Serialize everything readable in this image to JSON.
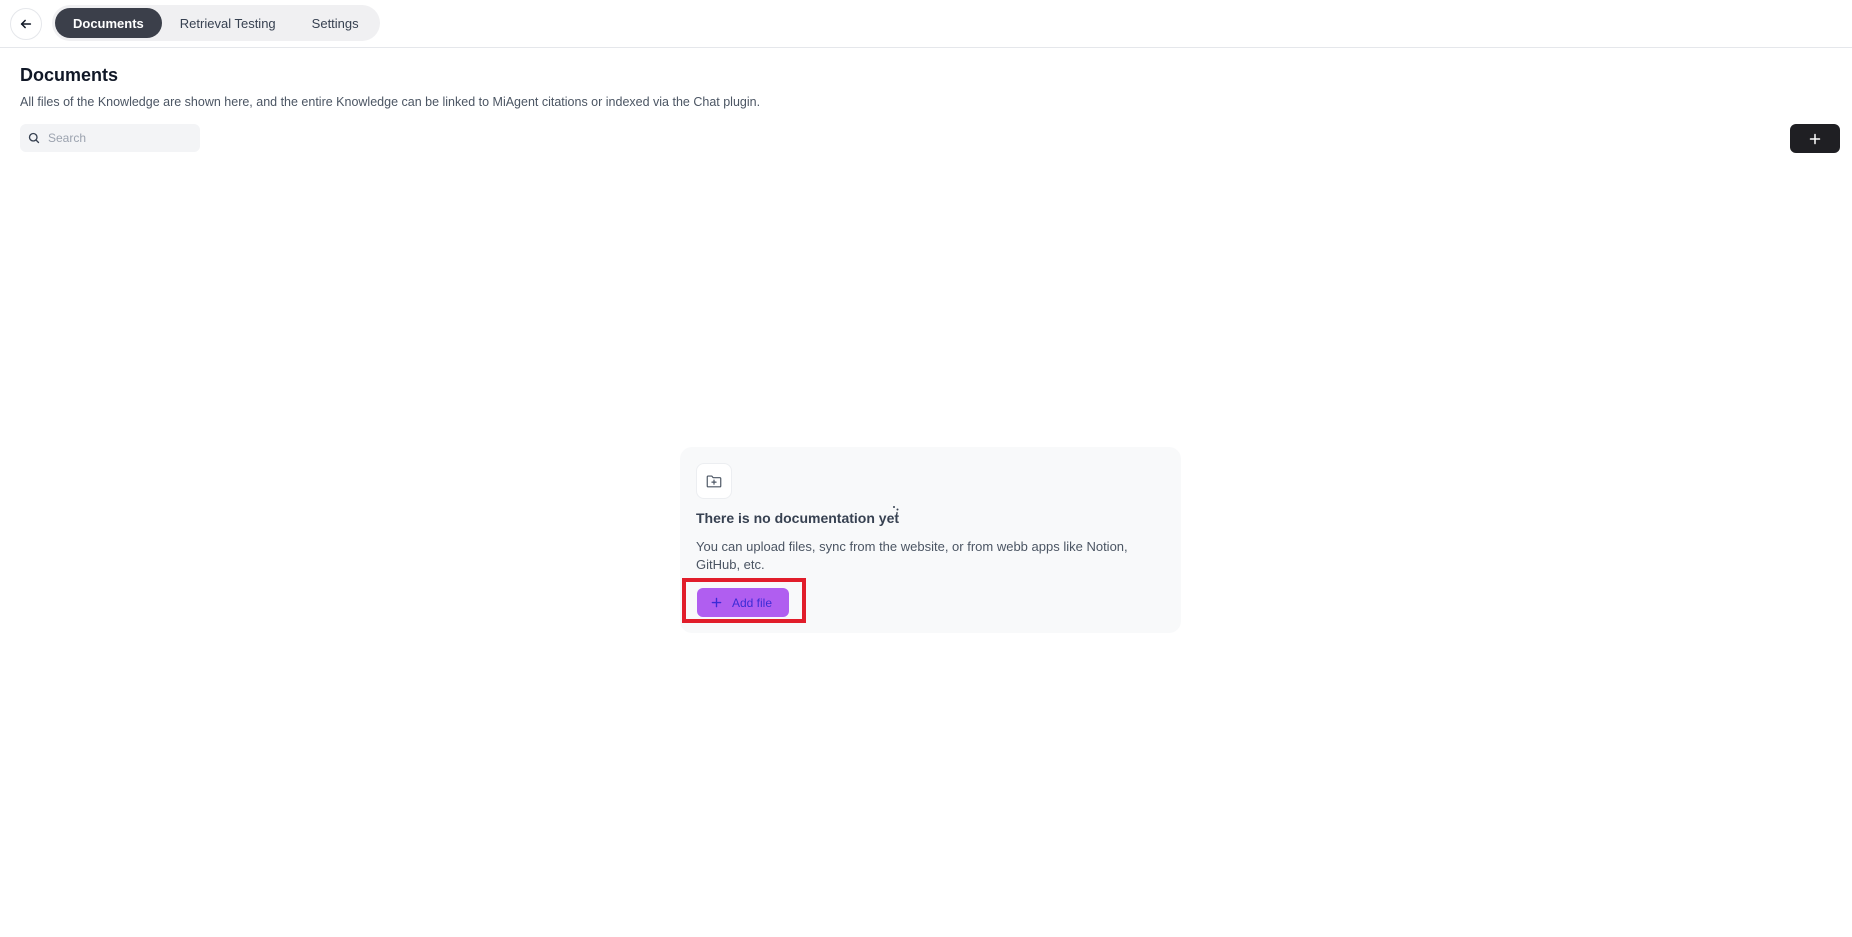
{
  "topbar": {
    "back_icon": "arrow-left-icon",
    "tabs": [
      {
        "label": "Documents",
        "active": true
      },
      {
        "label": "Retrieval Testing",
        "active": false
      },
      {
        "label": "Settings",
        "active": false
      }
    ]
  },
  "header": {
    "title": "Documents",
    "description": "All files of the Knowledge are shown here, and the entire Knowledge can be linked to MiAgent citations or indexed via the Chat plugin."
  },
  "search": {
    "placeholder": "Search",
    "value": ""
  },
  "actions": {
    "add_icon": "plus-icon"
  },
  "empty_state": {
    "icon": "folder-plus-icon",
    "title": "There is no documentation yet",
    "description": "You can upload files, sync from the website, or from webb apps like Notion, GitHub, etc.",
    "add_file_label": "Add file"
  },
  "colors": {
    "tab_active_bg": "#3b3f4a",
    "add_file_bg": "#b05ef0",
    "add_file_text": "#3b2bd6",
    "highlight": "#e11d2a",
    "top_add_bg": "#1f1f23"
  }
}
